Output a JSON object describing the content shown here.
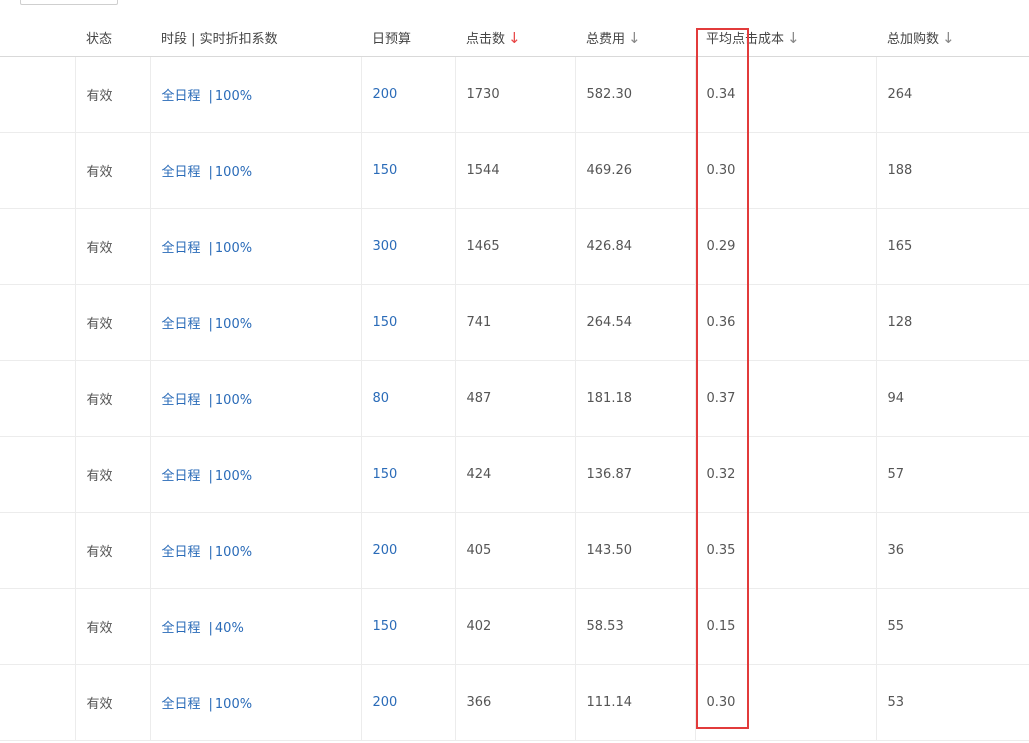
{
  "table": {
    "headers": [
      {
        "key": "lead",
        "label": ""
      },
      {
        "key": "status",
        "label": "状态"
      },
      {
        "key": "schedule",
        "label": "时段 | 实时折扣系数"
      },
      {
        "key": "budget",
        "label": "日预算"
      },
      {
        "key": "clicks",
        "label": "点击数",
        "sort_icon": "↓"
      },
      {
        "key": "cost",
        "label": "总费用",
        "sort_icon": "↓"
      },
      {
        "key": "cpc",
        "label": "平均点击成本",
        "sort_icon": "↓"
      },
      {
        "key": "cart",
        "label": "总加购数",
        "sort_icon": "↓"
      }
    ],
    "rows": [
      {
        "status": "有效",
        "schedule": "全日程",
        "discount": "100%",
        "budget": "200",
        "clicks": "1730",
        "cost": "582.30",
        "cpc": "0.34",
        "cart": "264"
      },
      {
        "status": "有效",
        "schedule": "全日程",
        "discount": "100%",
        "budget": "150",
        "clicks": "1544",
        "cost": "469.26",
        "cpc": "0.30",
        "cart": "188"
      },
      {
        "status": "有效",
        "schedule": "全日程",
        "discount": "100%",
        "budget": "300",
        "clicks": "1465",
        "cost": "426.84",
        "cpc": "0.29",
        "cart": "165"
      },
      {
        "status": "有效",
        "schedule": "全日程",
        "discount": "100%",
        "budget": "150",
        "clicks": "741",
        "cost": "264.54",
        "cpc": "0.36",
        "cart": "128"
      },
      {
        "status": "有效",
        "schedule": "全日程",
        "discount": "100%",
        "budget": "80",
        "clicks": "487",
        "cost": "181.18",
        "cpc": "0.37",
        "cart": "94"
      },
      {
        "status": "有效",
        "schedule": "全日程",
        "discount": "100%",
        "budget": "150",
        "clicks": "424",
        "cost": "136.87",
        "cpc": "0.32",
        "cart": "57"
      },
      {
        "status": "有效",
        "schedule": "全日程",
        "discount": "100%",
        "budget": "200",
        "clicks": "405",
        "cost": "143.50",
        "cpc": "0.35",
        "cart": "36"
      },
      {
        "status": "有效",
        "schedule": "全日程",
        "discount": "40%",
        "budget": "150",
        "clicks": "402",
        "cost": "58.53",
        "cpc": "0.15",
        "cart": "55"
      },
      {
        "status": "有效",
        "schedule": "全日程",
        "discount": "100%",
        "budget": "200",
        "clicks": "366",
        "cost": "111.14",
        "cpc": "0.30",
        "cart": "53"
      }
    ],
    "schedule_separator": "|"
  },
  "colors": {
    "link": "#2a6bb8",
    "sort_active": "#e84545",
    "sort_inactive": "#888888",
    "highlight": "#e23b3b"
  },
  "icons": {
    "clicks_sort": "sort-desc-active-icon",
    "other_sort": "sort-desc-icon"
  }
}
